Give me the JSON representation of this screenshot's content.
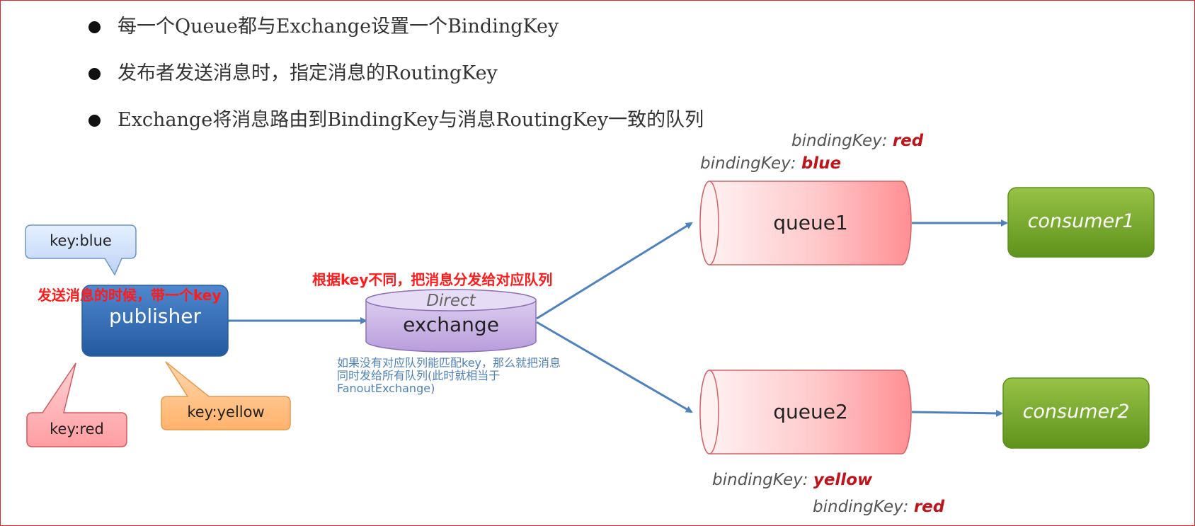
{
  "bullets": [
    "每一个Queue都与Exchange设置一个BindingKey",
    "发布者发送消息时，指定消息的RoutingKey",
    "Exchange将消息路由到BindingKey与消息RoutingKey一致的队列"
  ],
  "binding_keys": {
    "queue1_red": {
      "label": "bindingKey: ",
      "value": "red"
    },
    "queue1_blue": {
      "label": "bindingKey: ",
      "value": "blue"
    },
    "queue2_yellow": {
      "label": "bindingKey: ",
      "value": "yellow"
    },
    "queue2_red": {
      "label": "bindingKey: ",
      "value": "red"
    }
  },
  "nodes": {
    "publisher": "publisher",
    "exchange_type": "Direct",
    "exchange": "exchange",
    "queue1": "queue1",
    "queue2": "queue2",
    "consumer1": "consumer1",
    "consumer2": "consumer2"
  },
  "callouts": {
    "blue": "key:blue",
    "red": "key:red",
    "yellow": "key:yellow"
  },
  "notes": {
    "publisher_note": "发送消息的时候，带一个key",
    "exchange_note": "根据key不同，把消息分发给对应队列",
    "fallback_note": "如果没有对应队列能匹配key，那么就把消息同时发给所有队列(此时就相当于FanoutExchange)"
  },
  "colors": {
    "border": "#e0262b",
    "arrow": "#4f81bd",
    "publisher": "#2e6db4",
    "exchange": "#c9b3e6",
    "queue": "#ff8f93",
    "consumer": "#7aae2a",
    "highlight": "#c0141c",
    "note_red": "#ff1b1b"
  }
}
